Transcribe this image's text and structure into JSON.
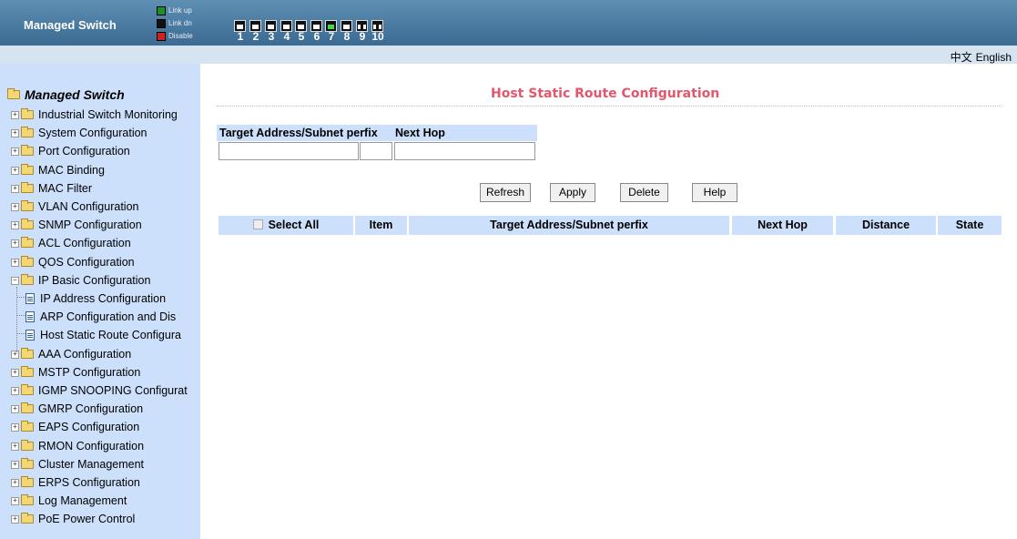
{
  "header": {
    "brand": "Managed Switch",
    "legend": [
      {
        "label": "Link up",
        "state": "up"
      },
      {
        "label": "Link dn",
        "state": "down"
      },
      {
        "label": "Disable",
        "state": "disable"
      }
    ],
    "ports": [
      {
        "num": "1",
        "state": "down",
        "kind": "copper"
      },
      {
        "num": "2",
        "state": "down",
        "kind": "copper"
      },
      {
        "num": "3",
        "state": "down",
        "kind": "copper"
      },
      {
        "num": "4",
        "state": "down",
        "kind": "copper"
      },
      {
        "num": "5",
        "state": "down",
        "kind": "copper"
      },
      {
        "num": "6",
        "state": "down",
        "kind": "copper"
      },
      {
        "num": "7",
        "state": "up",
        "kind": "copper"
      },
      {
        "num": "8",
        "state": "down",
        "kind": "copper"
      },
      {
        "num": "9",
        "state": "down",
        "kind": "fiber"
      },
      {
        "num": "10",
        "state": "down",
        "kind": "fiber"
      }
    ]
  },
  "lang": {
    "chinese": "中文",
    "english": "English"
  },
  "sidebar": {
    "root": "Managed Switch",
    "items": [
      "Industrial Switch Monitoring",
      "System Configuration",
      "Port Configuration",
      "MAC Binding",
      "MAC Filter",
      "VLAN Configuration",
      "SNMP Configuration",
      "ACL Configuration",
      "QOS Configuration",
      "IP Basic Configuration"
    ],
    "children": [
      "IP Address Configuration",
      "ARP Configuration and Dis",
      "Host Static Route Configura"
    ],
    "items_after": [
      "AAA Configuration",
      "MSTP Configuration",
      "IGMP SNOOPING Configurat",
      "GMRP Configuration",
      "EAPS Configuration",
      "RMON Configuration",
      "Cluster Management",
      "ERPS Configuration",
      "Log Management",
      "PoE Power Control"
    ]
  },
  "main": {
    "title": "Host Static Route Configuration",
    "form": {
      "target_label": "Target Address/Subnet perfix",
      "nexthop_label": "Next Hop",
      "target_value": "",
      "mask_value": "",
      "nexthop_value": ""
    },
    "buttons": {
      "refresh": "Refresh",
      "apply": "Apply",
      "delete": "Delete",
      "help": "Help"
    },
    "table": {
      "select_all": "Select All",
      "columns": [
        "Item",
        "Target Address/Subnet perfix",
        "Next Hop",
        "Distance",
        "State"
      ]
    }
  },
  "colors": {
    "header_bg": "#3b6a92",
    "sidebar_bg": "#cde0fb",
    "title": "#e4566b",
    "link_up": "#49d64a",
    "disable": "#cc2222"
  }
}
